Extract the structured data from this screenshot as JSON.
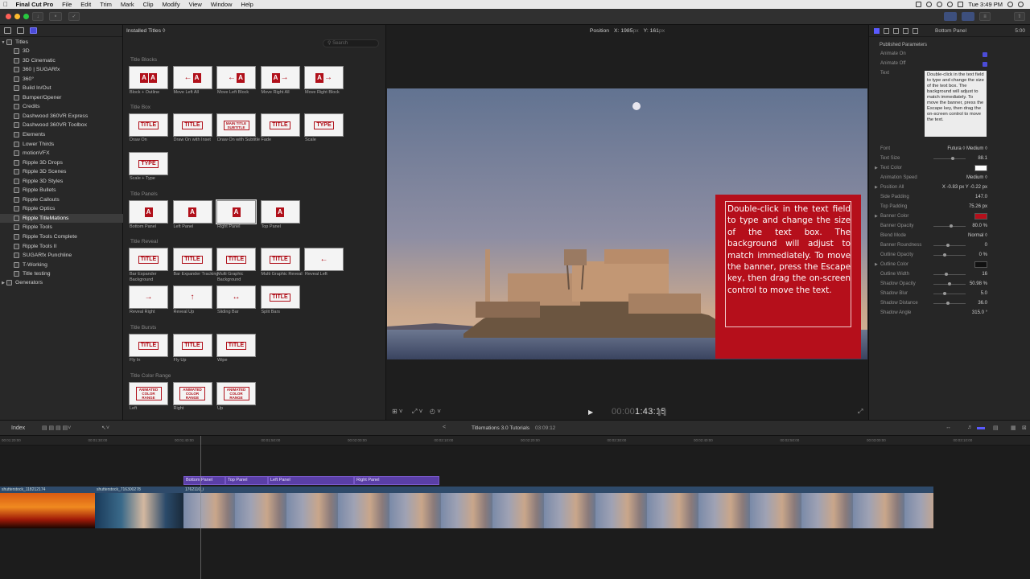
{
  "menubar": {
    "app": "Final Cut Pro",
    "items": [
      "File",
      "Edit",
      "Trim",
      "Mark",
      "Clip",
      "Modify",
      "View",
      "Window",
      "Help"
    ],
    "clock": "Tue 3:49 PM"
  },
  "sidebar": {
    "root": "Titles",
    "items": [
      "3D",
      "3D Cinematic",
      "360 | SUGARfx",
      "360°",
      "Build In/Out",
      "Bumper/Opener",
      "Credits",
      "Dashwood 360VR Express",
      "Dashwood 360VR Toolbox",
      "Elements",
      "Lower Thirds",
      "motionVFX",
      "Ripple 3D Drops",
      "Ripple 3D Scenes",
      "Ripple 3D Styles",
      "Ripple Bullets",
      "Ripple Callouts",
      "Ripple Optics",
      "Ripple TitleMations",
      "Ripple Tools",
      "Ripple Tools Complete",
      "Ripple Tools II",
      "SUGARfx Punchline",
      "T-Working",
      "Title testing"
    ],
    "selected_index": 18,
    "generators": "Generators"
  },
  "browser": {
    "header": "Installed Titles ◊",
    "search_placeholder": "Search",
    "sections": [
      {
        "name": "Title Blocks",
        "items": [
          {
            "label": "Block + Outline",
            "art": "AA"
          },
          {
            "label": "Move Left All",
            "art": "A"
          },
          {
            "label": "Move Left Block",
            "art": "A"
          },
          {
            "label": "Move Right All",
            "art": "A"
          },
          {
            "label": "Move Right Block",
            "art": "A"
          }
        ]
      },
      {
        "name": "Title Box",
        "items": [
          {
            "label": "Draw On",
            "art": "TITLE"
          },
          {
            "label": "Draw On with Inset",
            "art": "TITLE"
          },
          {
            "label": "Draw On with Subtitle",
            "art": "MAIN TITLE SUBTITLE"
          },
          {
            "label": "Fade",
            "art": "TITLE"
          },
          {
            "label": "Scale",
            "art": "TYPE"
          },
          {
            "label": "Scale + Type",
            "art": "TYPE"
          }
        ]
      },
      {
        "name": "Title Panels",
        "items": [
          {
            "label": "Bottom Panel",
            "art": "A"
          },
          {
            "label": "Left Panel",
            "art": "A"
          },
          {
            "label": "Right Panel",
            "art": "A"
          },
          {
            "label": "Top Panel",
            "art": "A"
          }
        ]
      },
      {
        "name": "Title Reveal",
        "items": [
          {
            "label": "Bar Expander Background",
            "art": "TITLE"
          },
          {
            "label": "Bar Expander Tracking",
            "art": "TITLE"
          },
          {
            "label": "Multi Graphic Background",
            "art": "TITLE"
          },
          {
            "label": "Multi Graphic Reveal",
            "art": "TITLE"
          },
          {
            "label": "Reveal Left",
            "art": ""
          },
          {
            "label": "Reveal Right",
            "art": ""
          },
          {
            "label": "Reveal Up",
            "art": ""
          },
          {
            "label": "Sliding Bar",
            "art": ""
          },
          {
            "label": "Split Bars",
            "art": "TITLE"
          }
        ]
      },
      {
        "name": "Title Bursts",
        "items": [
          {
            "label": "Fly In",
            "art": "TITLE"
          },
          {
            "label": "Fly Up",
            "art": "TITLE"
          },
          {
            "label": "Wipe",
            "art": "TITLE"
          }
        ]
      },
      {
        "name": "Title Color Range",
        "items": [
          {
            "label": "Left",
            "art": "ANIMATED COLOR RANGE"
          },
          {
            "label": "Right",
            "art": "ANIMATED COLOR RANGE"
          },
          {
            "label": "Up",
            "art": "ANIMATED COLOR RANGE"
          }
        ]
      }
    ]
  },
  "viewer": {
    "position_label": "Position",
    "x_label": "X: 1985",
    "x_unit": "px",
    "y_label": "Y: 161",
    "y_unit": "px",
    "banner_text": "Double-click in the text field to type and change the size of the text box. The background will adjust to match immediately. To move the banner, press the Escape key, then drag the on-screen control to move the text.",
    "timecode": "1:43:15",
    "timecode_prefix": "00:00"
  },
  "inspector": {
    "title": "Bottom Panel",
    "duration": "5:00",
    "section": "Published Parameters",
    "animate_on": "Animate On",
    "animate_off": "Animate Off",
    "text_label": "Text",
    "text_value": "Double-click in the text field to type and change the size of the text box. The background will adjust to match immediately. To move the banner, press the Escape key, then drag the on-screen control to move the text.",
    "params": [
      {
        "name": "Font",
        "value": "Futura ◊     Medium ◊"
      },
      {
        "name": "Text Size",
        "value": "88.1"
      },
      {
        "name": "Text Color",
        "value": "",
        "swatch": "#ffffff",
        "tri": true
      },
      {
        "name": "Animation Speed",
        "value": "Medium ◊"
      },
      {
        "name": "Position All",
        "value": "X   -0.83  px    Y   -0.22  px",
        "tri": true
      },
      {
        "name": "Side Padding",
        "value": "147.0"
      },
      {
        "name": "Top Padding",
        "value": "75.26  px"
      },
      {
        "name": "Banner Color",
        "value": "",
        "swatch": "#b50f1b",
        "tri": true
      },
      {
        "name": "Banner Opacity",
        "value": "80.0  %"
      },
      {
        "name": "Blend Mode",
        "value": "Normal ◊"
      },
      {
        "name": "Banner Roundness",
        "value": "0"
      },
      {
        "name": "Outline Opacity",
        "value": "0  %"
      },
      {
        "name": "Outline Color",
        "value": "",
        "swatch": "#111111",
        "tri": true
      },
      {
        "name": "Outline Width",
        "value": "16"
      },
      {
        "name": "Shadow Opacity",
        "value": "50.98  %"
      },
      {
        "name": "Shadow Blur",
        "value": "5.0"
      },
      {
        "name": "Shadow Distance",
        "value": "36.0"
      },
      {
        "name": "Shadow Angle",
        "value": "315.0 °"
      }
    ]
  },
  "timeline": {
    "index": "Index",
    "project": "Titlemations 3.0 Tutorials",
    "duration": "03:09:12",
    "ticks": [
      "00:01:20:00",
      "00:01:30:00",
      "00:01:40:00",
      "00:01:50:00",
      "00:02:00:00",
      "00:02:10:00",
      "00:02:20:00",
      "00:02:30:00",
      "00:02:40:00",
      "00:02:50:00",
      "00:03:00:00",
      "00:03:10:00"
    ],
    "title_clips": [
      "Bottom Panel",
      "Top Panel",
      "Left Panel",
      "Right Panel"
    ],
    "video_clips": [
      "shutterstock_118212174",
      "shutterstock_716300278",
      "1762110_i"
    ]
  }
}
